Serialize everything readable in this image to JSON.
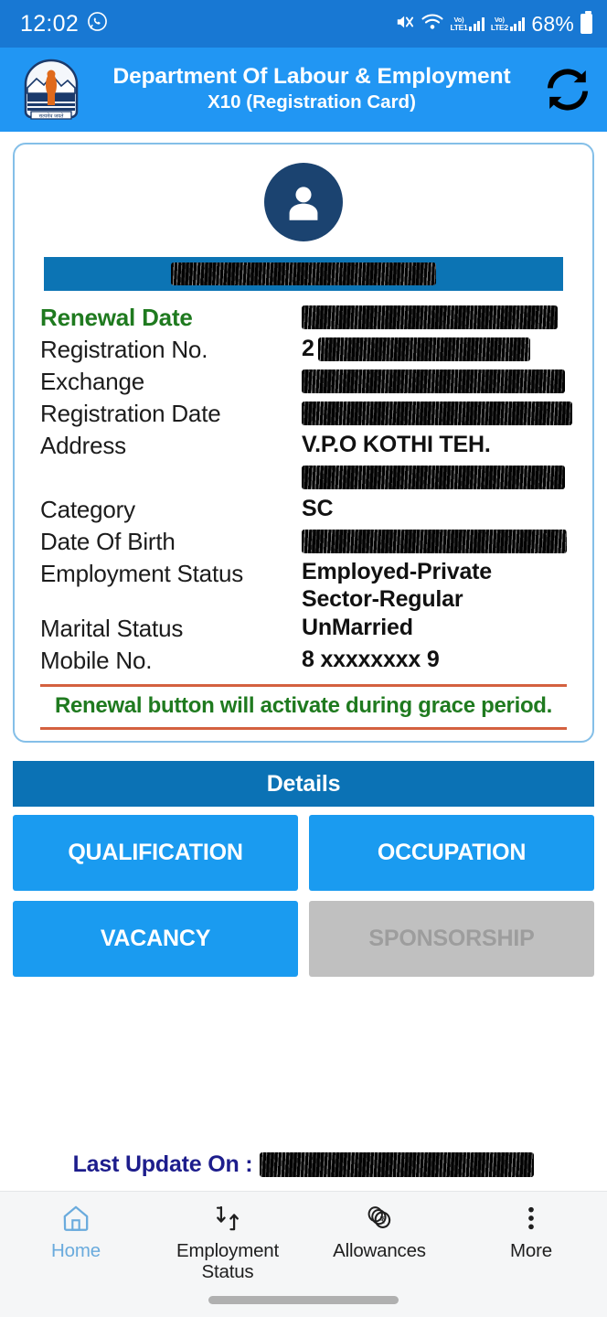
{
  "status_bar": {
    "time": "12:02",
    "whatsapp_icon": "whatsapp-icon",
    "mute_icon": "mute-icon",
    "wifi_icon": "wifi-icon",
    "sim1_label_top": "Vo)",
    "sim1_label_bottom": "LTE1",
    "sim2_label_top": "Vo)",
    "sim2_label_bottom": "LTE2",
    "battery_percent": "68%",
    "background_color": "#1878d3"
  },
  "header": {
    "emblem_icon": "government-emblem-icon",
    "title": "Department Of Labour & Employment",
    "subtitle": "X10 (Registration Card)",
    "refresh_icon": "refresh-icon",
    "background_color": "#2196f3"
  },
  "card": {
    "avatar_icon": "user-avatar-icon",
    "name_banner": {
      "value": "",
      "redacted": true,
      "background_color": "#0c74b4"
    },
    "fields": [
      {
        "label": "Renewal Date",
        "label_style": "green",
        "value": "",
        "redacted": true,
        "redact_width": 280
      },
      {
        "label": "Registration No.",
        "label_style": "normal",
        "value": "2",
        "redacted": true,
        "redact_width": 232
      },
      {
        "label": "Exchange",
        "label_style": "normal",
        "value": "",
        "redacted": true,
        "redact_width": 288
      },
      {
        "label": "Registration Date",
        "label_style": "normal",
        "value": "",
        "redacted": true,
        "redact_width": 296
      },
      {
        "label": "Address",
        "label_style": "normal",
        "value": "V.P.O KOTHI TEH.",
        "redacted": false
      },
      {
        "label": "",
        "label_style": "normal",
        "value": "",
        "redacted": true,
        "redact_width": 288
      },
      {
        "label": "Category",
        "label_style": "normal",
        "value": "SC",
        "redacted": false
      },
      {
        "label": "Date Of Birth",
        "label_style": "normal",
        "value": "",
        "redacted": true,
        "redact_width": 290
      },
      {
        "label": "Employment Status",
        "label_style": "normal",
        "value": "Employed-Private Sector-Regular",
        "redacted": false
      },
      {
        "label": "Marital Status",
        "label_style": "normal",
        "value": "UnMarried",
        "redacted": false
      },
      {
        "label": "Mobile No.",
        "label_style": "normal",
        "value": "8  xxxxxxxx 9",
        "redacted": false
      }
    ],
    "notice": "Renewal button will activate during grace period.",
    "notice_color": "#1f7a1f",
    "notice_rule_color": "#d4613f",
    "border_color": "#84bfe8"
  },
  "details": {
    "header_label": "Details",
    "header_color": "#0b72b5",
    "buttons": [
      {
        "label": "QUALIFICATION",
        "enabled": true
      },
      {
        "label": "OCCUPATION",
        "enabled": true
      },
      {
        "label": "VACANCY",
        "enabled": true
      },
      {
        "label": "SPONSORSHIP",
        "enabled": false
      }
    ],
    "button_color": "#1a9bf0",
    "disabled_color": "#c0c0c0"
  },
  "last_update": {
    "label": "Last Update On :",
    "value": "",
    "redacted": true,
    "color": "#1d1d8c"
  },
  "bottom_nav": {
    "items": [
      {
        "label": "Home",
        "icon": "home-icon",
        "active": true
      },
      {
        "label": "Employment\nStatus",
        "icon": "exchange-arrows-icon",
        "active": false
      },
      {
        "label": "Allowances",
        "icon": "rupee-coins-icon",
        "active": false
      },
      {
        "label": "More",
        "icon": "more-vertical-icon",
        "active": false
      }
    ],
    "active_color": "#6aabdd",
    "background_color": "#f5f6f7"
  }
}
